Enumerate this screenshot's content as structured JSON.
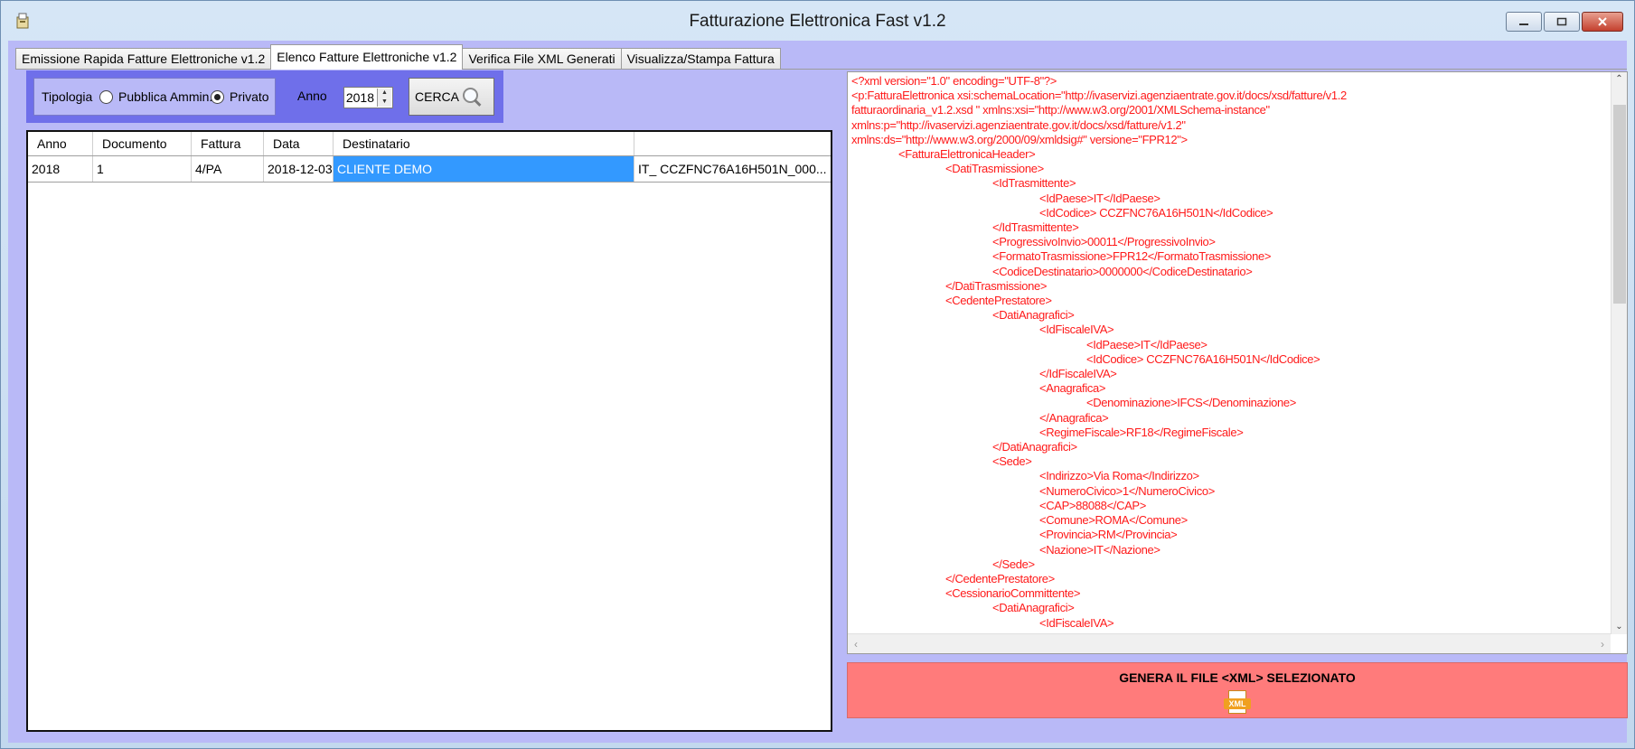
{
  "window": {
    "title": "Fatturazione Elettronica Fast v1.2"
  },
  "tabs": [
    {
      "label": "Emissione Rapida Fatture Elettroniche v1.2"
    },
    {
      "label": "Elenco Fatture Elettroniche v1.2"
    },
    {
      "label": "Verifica File XML Generati"
    },
    {
      "label": "Visualizza/Stampa Fattura"
    }
  ],
  "filter": {
    "tipologia_label": "Tipologia",
    "option_pa": "Pubblica Ammin.",
    "option_privato": "Privato",
    "selected": "Privato",
    "anno_label": "Anno",
    "anno_value": "2018",
    "cerca_label": "CERCA"
  },
  "grid": {
    "columns": [
      "Anno",
      "Documento",
      "Fattura",
      "Data",
      "Destinatario",
      ""
    ],
    "rows": [
      [
        "2018",
        "1",
        "4/PA",
        "2018-12-03",
        "CLIENTE DEMO",
        "IT_ CCZFNC76A16H501N_000..."
      ]
    ]
  },
  "xml": {
    "lines": [
      "<?xml version=\"1.0\" encoding=\"UTF-8\"?>",
      "<p:FatturaElettronica xsi:schemaLocation=\"http://ivaservizi.agenziaentrate.gov.it/docs/xsd/fatture/v1.2",
      "fatturaordinaria_v1.2.xsd \" xmlns:xsi=\"http://www.w3.org/2001/XMLSchema-instance\"",
      "xmlns:p=\"http://ivaservizi.agenziaentrate.gov.it/docs/xsd/fatture/v1.2\"",
      "xmlns:ds=\"http://www.w3.org/2000/09/xmldsig#\" versione=\"FPR12\">",
      "\t<FatturaElettronicaHeader>",
      "\t\t<DatiTrasmissione>",
      "\t\t\t<IdTrasmittente>",
      "\t\t\t\t<IdPaese>IT</IdPaese>",
      "\t\t\t\t<IdCodice> CCZFNC76A16H501N</IdCodice>",
      "\t\t\t</IdTrasmittente>",
      "\t\t\t<ProgressivoInvio>00011</ProgressivoInvio>",
      "\t\t\t<FormatoTrasmissione>FPR12</FormatoTrasmissione>",
      "\t\t\t<CodiceDestinatario>0000000</CodiceDestinatario>",
      "\t\t</DatiTrasmissione>",
      "\t\t<CedentePrestatore>",
      "\t\t\t<DatiAnagrafici>",
      "\t\t\t\t<IdFiscaleIVA>",
      "\t\t\t\t\t<IdPaese>IT</IdPaese>",
      "\t\t\t\t\t<IdCodice> CCZFNC76A16H501N</IdCodice>",
      "\t\t\t\t</IdFiscaleIVA>",
      "\t\t\t\t<Anagrafica>",
      "\t\t\t\t\t<Denominazione>IFCS</Denominazione>",
      "\t\t\t\t</Anagrafica>",
      "\t\t\t\t<RegimeFiscale>RF18</RegimeFiscale>",
      "\t\t\t</DatiAnagrafici>",
      "\t\t\t<Sede>",
      "\t\t\t\t<Indirizzo>Via Roma</Indirizzo>",
      "\t\t\t\t<NumeroCivico>1</NumeroCivico>",
      "\t\t\t\t<CAP>88088</CAP>",
      "\t\t\t\t<Comune>ROMA</Comune>",
      "\t\t\t\t<Provincia>RM</Provincia>",
      "\t\t\t\t<Nazione>IT</Nazione>",
      "\t\t\t</Sede>",
      "\t\t</CedentePrestatore>",
      "\t\t<CessionarioCommittente>",
      "\t\t\t<DatiAnagrafici>",
      "\t\t\t\t<IdFiscaleIVA>"
    ]
  },
  "generate": {
    "label": "GENERA IL FILE <XML> SELEZIONATO",
    "icon_text": "XML"
  },
  "colors": {
    "client_bg": "#b9b9f7",
    "filter_bg": "#6f6fea",
    "selection": "#3399ff",
    "xml_text": "#ff1a1a",
    "generate_bg": "#ff7b7b"
  }
}
